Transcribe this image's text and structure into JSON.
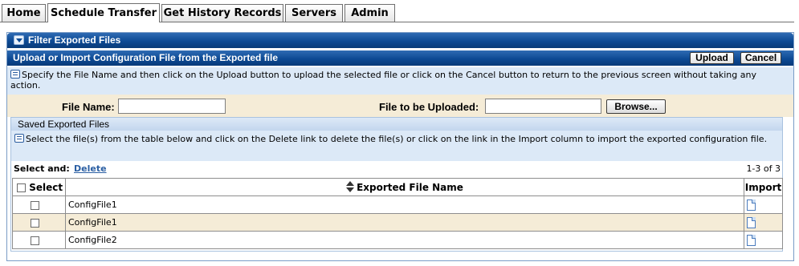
{
  "tabs": [
    {
      "label": "Home"
    },
    {
      "label": "Schedule Transfer",
      "active": true
    },
    {
      "label": "Get History Records"
    },
    {
      "label": "Servers"
    },
    {
      "label": "Admin"
    }
  ],
  "filter_bar": {
    "title": "Filter Exported Files",
    "toggle_icon": "collapse-arrow-icon"
  },
  "upload_section": {
    "title": "Upload or Import Configuration File from the Exported file",
    "upload_label": "Upload",
    "cancel_label": "Cancel",
    "info_text": "Specify the File Name and then click on the Upload button to upload the selected file or click on the Cancel button to return to the previous screen without taking any action."
  },
  "form": {
    "file_name_label": "File Name:",
    "file_name_value": "",
    "file_upload_label": "File to be Uploaded:",
    "file_upload_value": "",
    "browse_label": "Browse..."
  },
  "saved_files": {
    "title": "Saved Exported Files",
    "info_text": "Select the file(s) from the table below and click on the Delete link to delete the file(s) or click on the link in the Import column to import the exported configuration file.",
    "select_and_label": "Select and:",
    "delete_label": "Delete",
    "count_text": "1-3 of 3",
    "columns": {
      "select": "Select",
      "file_name": "Exported File Name",
      "import": "Import"
    },
    "rows": [
      {
        "file": "ConfigFile1",
        "checked": false
      },
      {
        "file": "ConfigFile1",
        "checked": false
      },
      {
        "file": "ConfigFile2",
        "checked": false
      }
    ]
  },
  "colors": {
    "header_bar": "#0d4a94",
    "info_bg": "#dce9f7",
    "form_bg": "#f5ecd7",
    "link": "#2b5fa3"
  }
}
